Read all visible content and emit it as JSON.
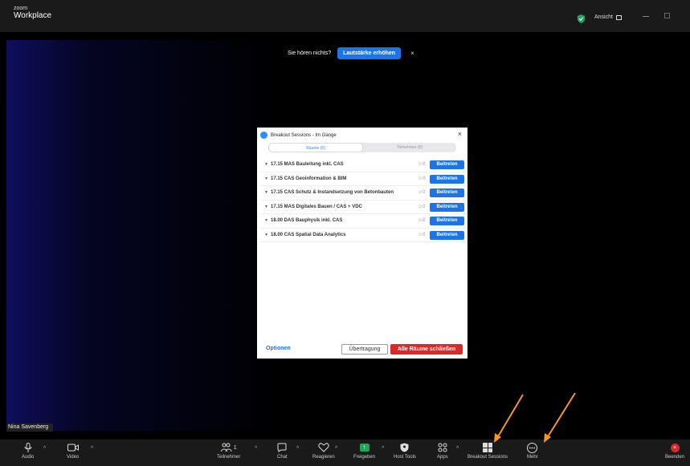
{
  "titlebar": {
    "logo_small": "zoom",
    "logo_main": "Workplace",
    "view_label": "Ansicht",
    "shield_color": "#1ea65a"
  },
  "notice": {
    "text": "Sie hören nichts?",
    "button": "Lautstärke erhöhen",
    "close": "×"
  },
  "participant_name": "Nina Savenberg",
  "dialog": {
    "title": "Breakout Sessions - Im Gange",
    "close": "×",
    "tabs": [
      {
        "label": "Räume (6)",
        "active": true
      },
      {
        "label": "Teilnehmer (0)",
        "active": false
      }
    ],
    "rooms": [
      {
        "name": "17.15 MAS Bauleitung inkl. CAS",
        "count": "0",
        "join": "Beitreten"
      },
      {
        "name": "17.15 CAS Geoinformation & BIM",
        "count": "0",
        "join": "Beitreten"
      },
      {
        "name": "17.15 CAS Schutz & Instandsetzung von Betonbauten",
        "count": "0",
        "join": "Beitreten"
      },
      {
        "name": "17.15 MAS Digitales Bauen / CAS + VDC",
        "count": "0",
        "join": "Beitreten"
      },
      {
        "name": "18.00 DAS Bauphysik inkl. CAS",
        "count": "0",
        "join": "Beitreten"
      },
      {
        "name": "18.00 CAS Spatial Data Analytics",
        "count": "0",
        "join": "Beitreten"
      }
    ],
    "options": "Optionen",
    "broadcast": "Übertragung",
    "close_all": "Alle Räume schließen"
  },
  "toolbar": {
    "audio": "Audio",
    "video": "Video",
    "participants": "Teilnehmer",
    "participants_count": "1",
    "chat": "Chat",
    "react": "Reagieren",
    "share": "Freigeben",
    "host_tools": "Host Tools",
    "apps": "Apps",
    "breakout": "Breakout Sessions",
    "more": "Mehr",
    "end": "Beenden"
  },
  "colors": {
    "accent": "#1b74e8",
    "danger": "#e02727",
    "annotation": "#f5962a"
  }
}
